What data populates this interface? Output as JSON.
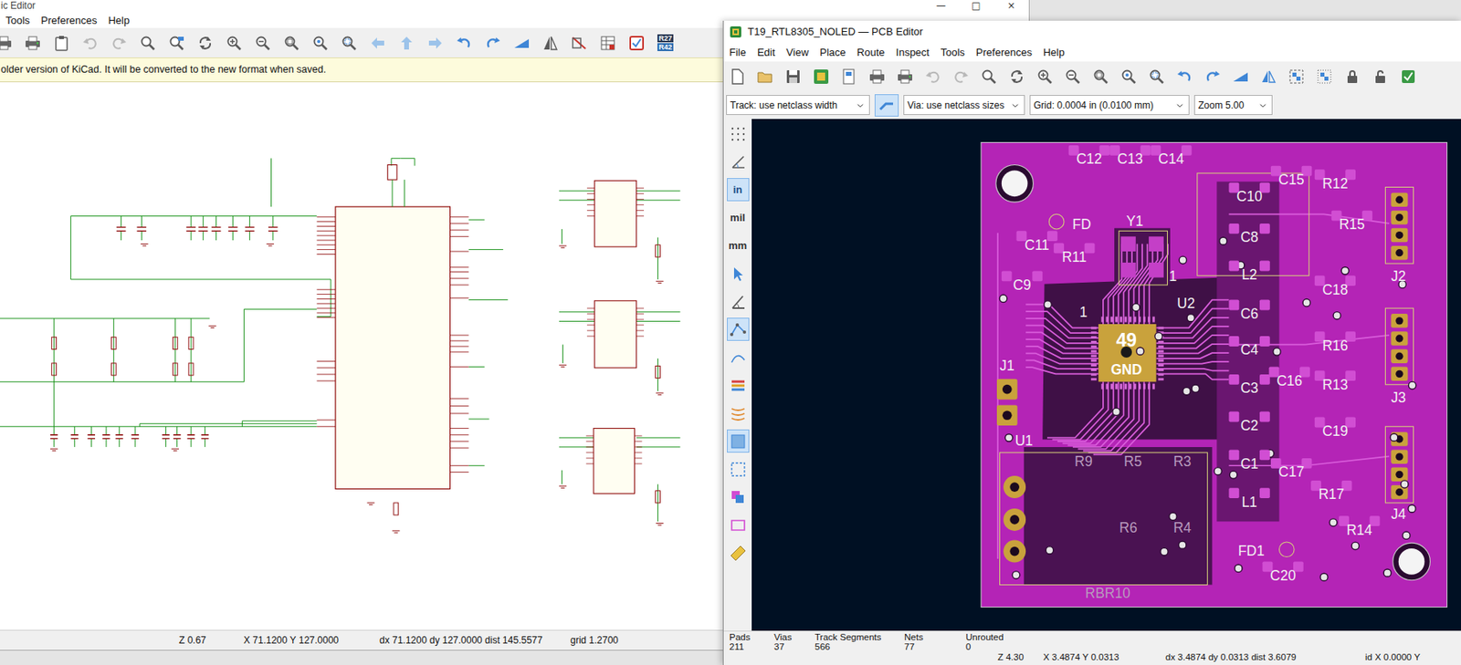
{
  "schematic_window": {
    "title": "ic Editor",
    "controls": [
      "—",
      "□",
      "×"
    ],
    "menu": [
      "Tools",
      "Preferences",
      "Help"
    ],
    "annotate_icon": [
      "R27",
      "R42"
    ],
    "infobar": "older version of KiCad. It will be converted to the new format when saved.",
    "status_bar": [
      "Z 0.67",
      "X 71.1200 Y 127.0000",
      "dx 71.1200 dy 127.0000 dist 145.5577",
      "grid 1.2700"
    ]
  },
  "pcb_window": {
    "title": "T19_RTL8305_NOLED — PCB Editor",
    "menu": [
      "File",
      "Edit",
      "View",
      "Place",
      "Route",
      "Inspect",
      "Tools",
      "Preferences",
      "Help"
    ],
    "track_select": "Track: use netclass width",
    "via_select": "Via: use netclass sizes",
    "grid_select": "Grid: 0.0004 in (0.0100 mm)",
    "zoom_select": "Zoom 5.00",
    "units": [
      {
        "label": "in",
        "selected": true
      },
      {
        "label": "mil",
        "selected": false
      },
      {
        "label": "mm",
        "selected": false
      }
    ],
    "board_labels": [
      {
        "text": "C12",
        "kind": "silk"
      },
      {
        "text": "C13",
        "kind": "silk"
      },
      {
        "text": "C14",
        "kind": "silk"
      },
      {
        "text": "C15",
        "kind": "silk"
      },
      {
        "text": "R12",
        "kind": "silk"
      },
      {
        "text": "C10",
        "kind": "silk"
      },
      {
        "text": "R15",
        "kind": "silk"
      },
      {
        "text": "FD",
        "kind": "silk"
      },
      {
        "text": "Y1",
        "kind": "silk"
      },
      {
        "text": "C8",
        "kind": "silk"
      },
      {
        "text": "J2",
        "kind": "silk"
      },
      {
        "text": "C11",
        "kind": "silk"
      },
      {
        "text": "R11",
        "kind": "silk"
      },
      {
        "text": "L2",
        "kind": "silk"
      },
      {
        "text": "C18",
        "kind": "silk"
      },
      {
        "text": "C9",
        "kind": "silk"
      },
      {
        "text": "1",
        "kind": "silk"
      },
      {
        "text": "1",
        "kind": "silk"
      },
      {
        "text": "U2",
        "kind": "silk"
      },
      {
        "text": "C6",
        "kind": "silk"
      },
      {
        "text": "49",
        "kind": "pad"
      },
      {
        "text": "GND",
        "kind": "pad"
      },
      {
        "text": "R16",
        "kind": "silk"
      },
      {
        "text": "C4",
        "kind": "silk"
      },
      {
        "text": "J3",
        "kind": "silk"
      },
      {
        "text": "J1",
        "kind": "silk"
      },
      {
        "text": "C16",
        "kind": "silk"
      },
      {
        "text": "R13",
        "kind": "silk"
      },
      {
        "text": "C3",
        "kind": "silk"
      },
      {
        "text": "C2",
        "kind": "silk"
      },
      {
        "text": "C19",
        "kind": "silk"
      },
      {
        "text": "U1",
        "kind": "silk"
      },
      {
        "text": "R9",
        "kind": "back"
      },
      {
        "text": "R5",
        "kind": "back"
      },
      {
        "text": "R3",
        "kind": "back"
      },
      {
        "text": "C1",
        "kind": "silk"
      },
      {
        "text": "C17",
        "kind": "silk"
      },
      {
        "text": "R17",
        "kind": "silk"
      },
      {
        "text": "J4",
        "kind": "silk"
      },
      {
        "text": "L1",
        "kind": "silk"
      },
      {
        "text": "R6",
        "kind": "back"
      },
      {
        "text": "R4",
        "kind": "back"
      },
      {
        "text": "FD1",
        "kind": "silk"
      },
      {
        "text": "R14",
        "kind": "silk"
      },
      {
        "text": "C20",
        "kind": "silk"
      },
      {
        "text": "RBR10",
        "kind": "back"
      }
    ],
    "status_bar": [
      {
        "label": "Pads",
        "value": "211"
      },
      {
        "label": "Vias",
        "value": "37"
      },
      {
        "label": "Track Segments",
        "value": "566"
      },
      {
        "label": "Nets",
        "value": "77"
      },
      {
        "label": "Unrouted",
        "value": "0"
      }
    ],
    "coords_bar": [
      "Z 4.30",
      "X 3.4874 Y 0.0313",
      "dx 3.4874 dy 0.0313 dist 3.6079",
      "id X 0.0000 Y"
    ]
  }
}
